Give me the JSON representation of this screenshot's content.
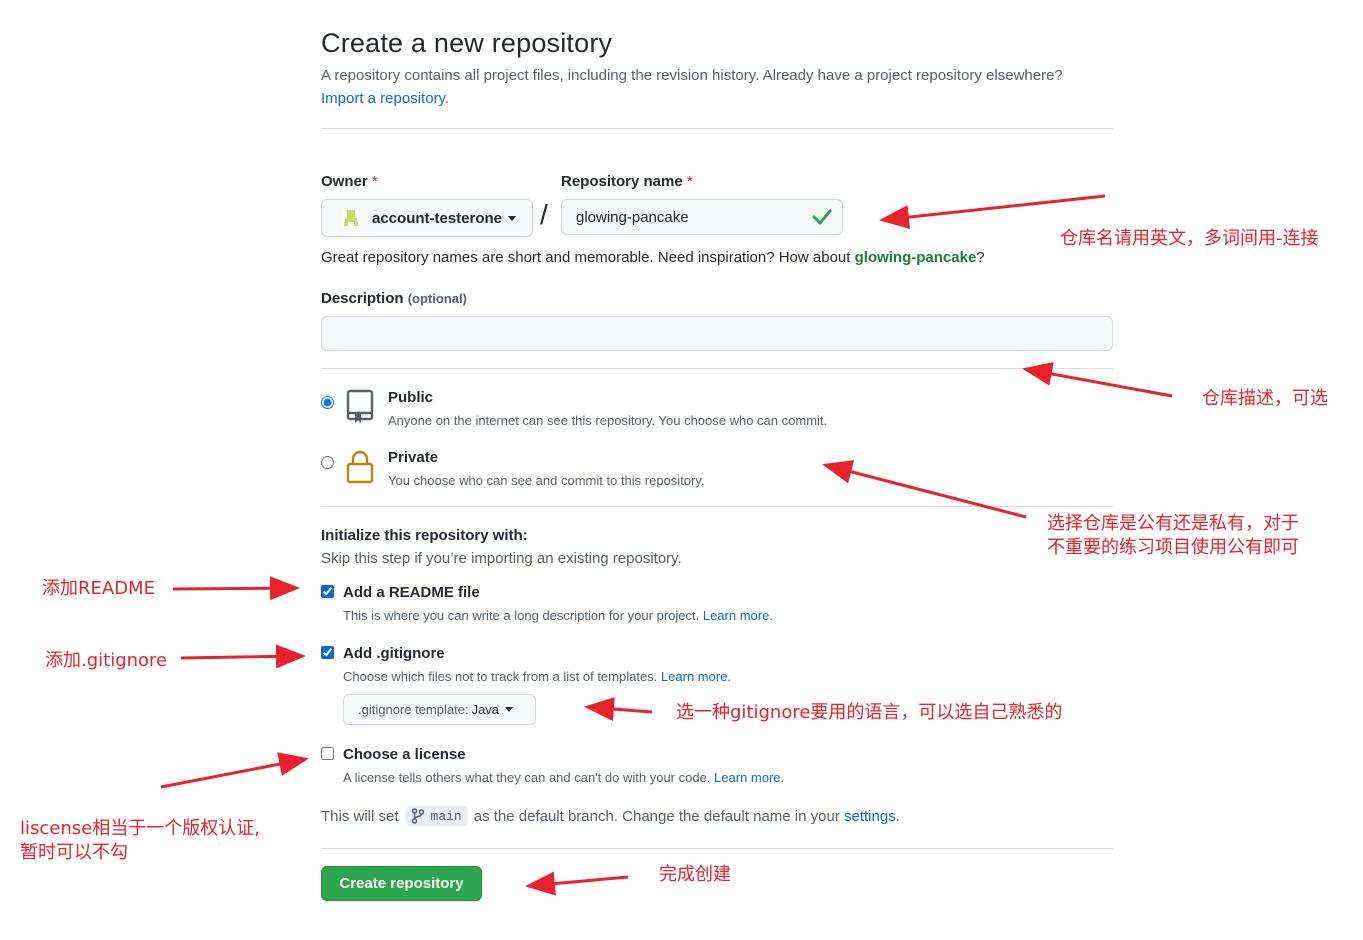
{
  "header": {
    "title": "Create a new repository",
    "subtitle": "A repository contains all project files, including the revision history. Already have a project repository elsewhere?",
    "import_link": "Import a repository."
  },
  "owner": {
    "label": "Owner",
    "required_mark": "*",
    "value": "account-testerone"
  },
  "repo_name": {
    "label": "Repository name",
    "required_mark": "*",
    "value": "glowing-pancake",
    "separator": "/"
  },
  "hint": {
    "prefix": "Great repository names are short and memorable. Need inspiration? How about ",
    "suggestion": "glowing-pancake",
    "suffix": "?"
  },
  "description": {
    "label": "Description",
    "optional": "(optional)",
    "value": ""
  },
  "visibility": {
    "public_title": "Public",
    "public_desc": "Anyone on the internet can see this repository. You choose who can commit.",
    "private_title": "Private",
    "private_desc": "You choose who can see and commit to this repository.",
    "selected": "public"
  },
  "init": {
    "title": "Initialize this repository with:",
    "subtitle": "Skip this step if you’re importing an existing repository.",
    "readme_label": "Add a README file",
    "readme_desc": "This is where you can write a long description for your project.",
    "readme_checked": true,
    "gitignore_label": "Add .gitignore",
    "gitignore_desc": "Choose which files not to track from a list of templates.",
    "gitignore_checked": true,
    "template_prefix": ".gitignore template:",
    "template_value": "Java",
    "license_label": "Choose a license",
    "license_desc": "A license tells others what they can and can't do with your code.",
    "license_checked": false,
    "learn_more": "Learn more."
  },
  "branch": {
    "prefix": "This will set",
    "name": "main",
    "middle": "as the default branch. Change the default name in your",
    "settings_link": "settings",
    "suffix": "."
  },
  "submit": {
    "label": "Create repository"
  },
  "annotations": {
    "repo_name": "仓库名请用英文，多词间用-连接",
    "description": "仓库描述，可选",
    "visibility_1": "选择仓库是公有还是私有，对于",
    "visibility_2": "不重要的练习项目使用公有即可",
    "readme": "添加README",
    "gitignore": "添加.gitignore",
    "template": "选一种gitignore要用的语言，可以选自己熟悉的",
    "license_1": "liscense相当于一个版权认证,",
    "license_2": "暂时可以不勾",
    "create": "完成创建"
  },
  "colors": {
    "accent": "#0969da",
    "primary_button": "#2da44e",
    "annotation": "#e8212a",
    "valid_check": "#2da44e"
  }
}
